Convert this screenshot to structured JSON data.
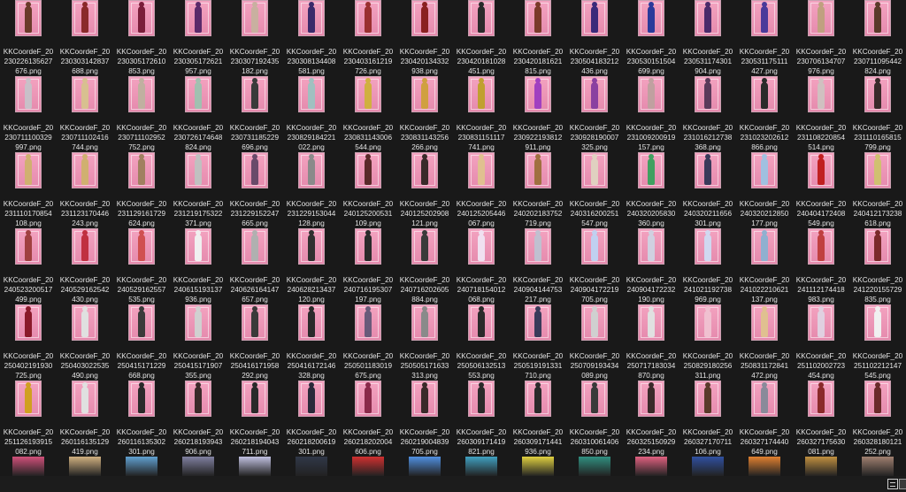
{
  "window": {
    "view_modes": [
      "details-view",
      "large-icons-view"
    ]
  },
  "colors": {
    "background": "#191919",
    "card_pink": "#f09ab9",
    "text": "#e4e4e4"
  },
  "files": [
    [
      "KKCoordeF_20",
      "230226135627",
      "676.png"
    ],
    [
      "KKCoordeF_20",
      "230303142837",
      "688.png"
    ],
    [
      "KKCoordeF_20",
      "230305172610",
      "853.png"
    ],
    [
      "KKCoordeF_20",
      "230305172621",
      "957.png"
    ],
    [
      "KKCoordeF_20",
      "230307192435",
      "182.png"
    ],
    [
      "KKCoordeF_20",
      "230308134408",
      "581.png"
    ],
    [
      "KKCoordeF_20",
      "230403161219",
      "726.png"
    ],
    [
      "KKCoordeF_20",
      "230420134332",
      "938.png"
    ],
    [
      "KKCoordeF_20",
      "230420181028",
      "451.png"
    ],
    [
      "KKCoordeF_20",
      "230420181621",
      "815.png"
    ],
    [
      "KKCoordeF_20",
      "230504183212",
      "436.png"
    ],
    [
      "KKCoordeF_20",
      "230530151504",
      "699.png"
    ],
    [
      "KKCoordeF_20",
      "230531174301",
      "904.png"
    ],
    [
      "KKCoordeF_20",
      "230531175111",
      "427.png"
    ],
    [
      "KKCoordeF_20",
      "230706134707",
      "976.png"
    ],
    [
      "KKCoordeF_20",
      "230711095442",
      "824.png"
    ],
    [
      "KKCoordeF_20",
      "230711100329",
      "997.png"
    ],
    [
      "KKCoordeF_20",
      "230711102416",
      "744.png"
    ],
    [
      "KKCoordeF_20",
      "230711102952",
      "752.png"
    ],
    [
      "KKCoordeF_20",
      "230726174648",
      "824.png"
    ],
    [
      "KKCoordeF_20",
      "230731185229",
      "696.png"
    ],
    [
      "KKCoordeF_20",
      "230829184221",
      "022.png"
    ],
    [
      "KKCoordeF_20",
      "230831143006",
      "544.png"
    ],
    [
      "KKCoordeF_20",
      "230831143256",
      "266.png"
    ],
    [
      "KKCoordeF_20",
      "230831151117",
      "741.png"
    ],
    [
      "KKCoordeF_20",
      "230922193812",
      "911.png"
    ],
    [
      "KKCoordeF_20",
      "230928190007",
      "325.png"
    ],
    [
      "KKCoordeF_20",
      "231009200919",
      "157.png"
    ],
    [
      "KKCoordeF_20",
      "231016212738",
      "368.png"
    ],
    [
      "KKCoordeF_20",
      "231023202612",
      "866.png"
    ],
    [
      "KKCoordeF_20",
      "231108220854",
      "514.png"
    ],
    [
      "KKCoordeF_20",
      "231110165815",
      "799.png"
    ],
    [
      "KKCoordeF_20",
      "231110170854",
      "108.png"
    ],
    [
      "KKCoordeF_20",
      "231123170446",
      "243.png"
    ],
    [
      "KKCoordeF_20",
      "231129161729",
      "624.png"
    ],
    [
      "KKCoordeF_20",
      "231219175322",
      "371.png"
    ],
    [
      "KKCoordeF_20",
      "231229152247",
      "665.png"
    ],
    [
      "KKCoordeF_20",
      "231229153044",
      "128.png"
    ],
    [
      "KKCoordeF_20",
      "240125200531",
      "109.png"
    ],
    [
      "KKCoordeF_20",
      "240125202908",
      "121.png"
    ],
    [
      "KKCoordeF_20",
      "240125205446",
      "067.png"
    ],
    [
      "KKCoordeF_20",
      "240202183752",
      "719.png"
    ],
    [
      "KKCoordeF_20",
      "240316200251",
      "547.png"
    ],
    [
      "KKCoordeF_20",
      "240320205830",
      "360.png"
    ],
    [
      "KKCoordeF_20",
      "240320211656",
      "301.png"
    ],
    [
      "KKCoordeF_20",
      "240320212850",
      "177.png"
    ],
    [
      "KKCoordeF_20",
      "240404172408",
      "549.png"
    ],
    [
      "KKCoordeF_20",
      "240412173238",
      "618.png"
    ],
    [
      "KKCoordeF_20",
      "240523200517",
      "499.png"
    ],
    [
      "KKCoordeF_20",
      "240529162542",
      "430.png"
    ],
    [
      "KKCoordeF_20",
      "240529162557",
      "535.png"
    ],
    [
      "KKCoordeF_20",
      "240615193137",
      "936.png"
    ],
    [
      "KKCoordeF_20",
      "240626164147",
      "657.png"
    ],
    [
      "KKCoordeF_20",
      "240628213437",
      "120.png"
    ],
    [
      "KKCoordeF_20",
      "240716195307",
      "197.png"
    ],
    [
      "KKCoordeF_20",
      "240716202605",
      "884.png"
    ],
    [
      "KKCoordeF_20",
      "240718154012",
      "068.png"
    ],
    [
      "KKCoordeF_20",
      "240904144753",
      "217.png"
    ],
    [
      "KKCoordeF_20",
      "240904172219",
      "705.png"
    ],
    [
      "KKCoordeF_20",
      "240904172232",
      "190.png"
    ],
    [
      "KKCoordeF_20",
      "241021192738",
      "969.png"
    ],
    [
      "KKCoordeF_20",
      "241022210621",
      "137.png"
    ],
    [
      "KKCoordeF_20",
      "241112174418",
      "983.png"
    ],
    [
      "KKCoordeF_20",
      "241220155729",
      "835.png"
    ],
    [
      "KKCoordeF_20",
      "250402191930",
      "725.png"
    ],
    [
      "KKCoordeF_20",
      "250403022535",
      "490.png"
    ],
    [
      "KKCoordeF_20",
      "250415171229",
      "668.png"
    ],
    [
      "KKCoordeF_20",
      "250415171907",
      "355.png"
    ],
    [
      "KKCoordeF_20",
      "250416171958",
      "292.png"
    ],
    [
      "KKCoordeF_20",
      "250416172146",
      "328.png"
    ],
    [
      "KKCoordeF_20",
      "250501183019",
      "675.png"
    ],
    [
      "KKCoordeF_20",
      "250505171633",
      "313.png"
    ],
    [
      "KKCoordeF_20",
      "250506132513",
      "553.png"
    ],
    [
      "KKCoordeF_20",
      "250519191331",
      "710.png"
    ],
    [
      "KKCoordeF_20",
      "250709193434",
      "089.png"
    ],
    [
      "KKCoordeF_20",
      "250717183034",
      "870.png"
    ],
    [
      "KKCoordeF_20",
      "250829180256",
      "311.png"
    ],
    [
      "KKCoordeF_20",
      "250831172841",
      "472.png"
    ],
    [
      "KKCoordeF_20",
      "251102002723",
      "454.png"
    ],
    [
      "KKCoordeF_20",
      "251102212147",
      "545.png"
    ],
    [
      "KKCoordeF_20",
      "251126193915",
      "082.png"
    ],
    [
      "KKCoordeF_20",
      "260116135129",
      "419.png"
    ],
    [
      "KKCoordeF_20",
      "260116135302",
      "301.png"
    ],
    [
      "KKCoordeF_20",
      "260218193943",
      "906.png"
    ],
    [
      "KKCoordeF_20",
      "260218194043",
      "711.png"
    ],
    [
      "KKCoordeF_20",
      "260218200619",
      "301.png"
    ],
    [
      "KKCoordeF_20",
      "260218202004",
      "606.png"
    ],
    [
      "KKCoordeF_20",
      "260219004839",
      "705.png"
    ],
    [
      "KKCoordeF_20",
      "260309171419",
      "821.png"
    ],
    [
      "KKCoordeF_20",
      "260309171441",
      "936.png"
    ],
    [
      "KKCoordeF_20",
      "260310061406",
      "850.png"
    ],
    [
      "KKCoordeF_20",
      "260325150929",
      "234.png"
    ],
    [
      "KKCoordeF_20",
      "260327170711",
      "106.png"
    ],
    [
      "KKCoordeF_20",
      "260327174440",
      "649.png"
    ],
    [
      "KKCoordeF_20",
      "260327175630",
      "081.png"
    ],
    [
      "KKCoordeF_20",
      "260328180121",
      "252.png"
    ]
  ],
  "outfit_colors": [
    "#6b3a2a",
    "#8a2a2a",
    "#7a1e3a",
    "#5a2a6a",
    "#c9b0a0",
    "#3a2a6a",
    "#9a3030",
    "#8a2020",
    "#2a2a2a",
    "#7a3a2a",
    "#3a2a7a",
    "#2a3a9a",
    "#4a2a6a",
    "#4a3a9a",
    "#c0a080",
    "#5a3a2a",
    "#c8c0c8",
    "#d8c090",
    "#c0b0a0",
    "#a0c0b0",
    "#3a3a3a",
    "#a0c0c0",
    "#d0b040",
    "#d0a040",
    "#c0a030",
    "#a040c0",
    "#8a40a0",
    "#c0a0a0",
    "#5a3a5a",
    "#2a2a2a",
    "#d0c0c0",
    "#3a2a2a",
    "#d0b070",
    "#d0b070",
    "#a08060",
    "#c0c0c0",
    "#6a4a6a",
    "#8a8a8a",
    "#5a2a2a",
    "#3a2a2a",
    "#e0c090",
    "#a07040",
    "#e0d0c0",
    "#40a060",
    "#3a3a5a",
    "#a0c0e0",
    "#c02020",
    "#d0c070",
    "#a04040",
    "#c03040",
    "#d05050",
    "#f0f0f0",
    "#b0b0b0",
    "#303030",
    "#2a2a2a",
    "#3a3a3a",
    "#f0e0f0",
    "#c0c0d0",
    "#c0d0f0",
    "#d0d0e0",
    "#d0d8f0",
    "#90b0d0",
    "#c04040",
    "#7a2a2a",
    "#8a1a2a",
    "#e0e0e0",
    "#3a3a3a",
    "#d0d0d0",
    "#3a3a3a",
    "#2a2a2a",
    "#6a5a7a",
    "#8a8a8a",
    "#2a2a2a",
    "#3a3a5a",
    "#d0d0d0",
    "#e0e0e0",
    "#f0c0d0",
    "#e0c090",
    "#e0d0e0",
    "#f0f0f0",
    "#d0a020",
    "#e0e0e0",
    "#2a2a2a",
    "#3a2a2a",
    "#2a2a2a",
    "#2a2a3a",
    "#8a2a4a",
    "#3a2a2a",
    "#2a2a2a",
    "#2a2a2a",
    "#3a3a3a",
    "#3a2a2a",
    "#5a3a2a",
    "#8a8a9a",
    "#8a2a2a",
    "#6a2a2a"
  ],
  "thumbs": [
    {
      "name": "thumb-pink-card",
      "color": "#d0507a"
    },
    {
      "name": "thumb-blonde-character",
      "color": "#d0b080"
    },
    {
      "name": "thumb-blue-anime",
      "color": "#60a0d0"
    },
    {
      "name": "thumb-grey-anime",
      "color": "#8080a0"
    },
    {
      "name": "thumb-silver-character",
      "color": "#c0c0e0"
    },
    {
      "name": "thumb-dark-anime",
      "color": "#303848"
    },
    {
      "name": "thumb-red-umbrella",
      "color": "#d03030"
    },
    {
      "name": "thumb-blue-sky",
      "color": "#5090e0"
    },
    {
      "name": "thumb-cyan-anime",
      "color": "#40a0c0"
    },
    {
      "name": "thumb-colorful",
      "color": "#e0d040"
    },
    {
      "name": "thumb-teal-anime",
      "color": "#309080"
    },
    {
      "name": "thumb-pink-hair",
      "color": "#e06080"
    },
    {
      "name": "thumb-poster",
      "color": "#3050a0"
    },
    {
      "name": "thumb-orange",
      "color": "#e08030"
    },
    {
      "name": "thumb-gold",
      "color": "#c09040"
    },
    {
      "name": "thumb-mixed",
      "color": "#a08070"
    }
  ]
}
